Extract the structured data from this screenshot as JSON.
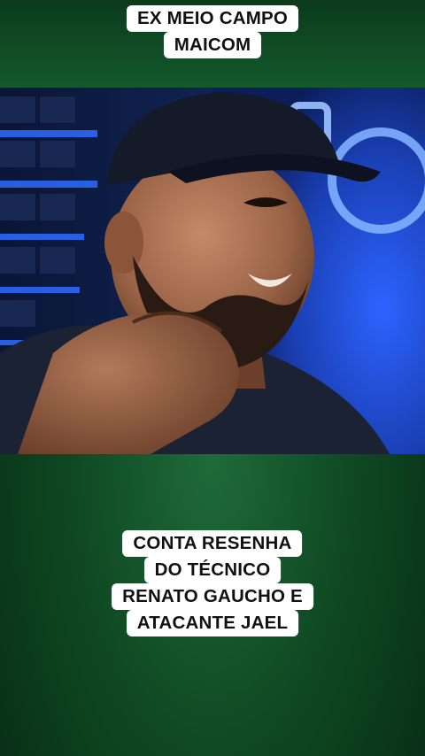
{
  "caption_top": {
    "lines": [
      "EX MEIO CAMPO",
      "MAICOM"
    ]
  },
  "caption_bottom": {
    "lines": [
      "CONTA RESENHA",
      "DO TÉCNICO",
      "RENATO GAUCHO E",
      "ATACANTE JAEL"
    ]
  },
  "colors": {
    "background_green": "#1f6b3a",
    "caption_bg": "#ffffff",
    "caption_text": "#111111",
    "studio_blue": "#1e4fd6"
  },
  "video": {
    "description_visible": false
  }
}
